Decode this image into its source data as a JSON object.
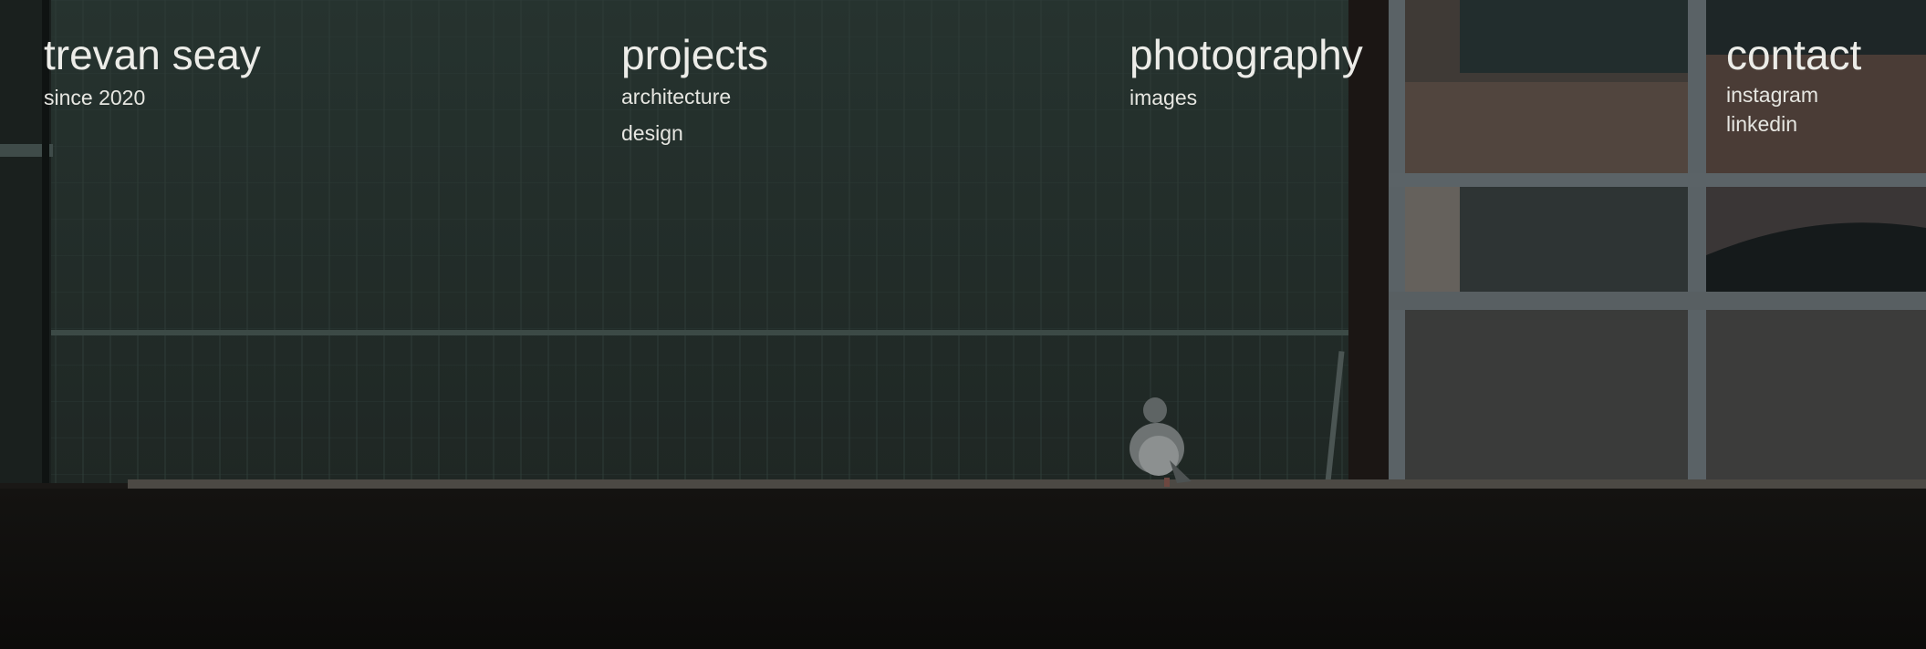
{
  "site": {
    "name": "trevan seay",
    "tagline": "since 2020"
  },
  "nav": {
    "projects": {
      "label": "projects",
      "items": [
        "architecture",
        "design"
      ]
    },
    "photography": {
      "label": "photography",
      "items": [
        "images"
      ]
    },
    "contact": {
      "label": "contact",
      "items": [
        "instagram",
        "linkedin"
      ]
    }
  },
  "colors": {
    "text": "#ebebe6",
    "wall": "#263330",
    "ledge": "#0f0e0d",
    "window_frame": "#5a6266"
  }
}
